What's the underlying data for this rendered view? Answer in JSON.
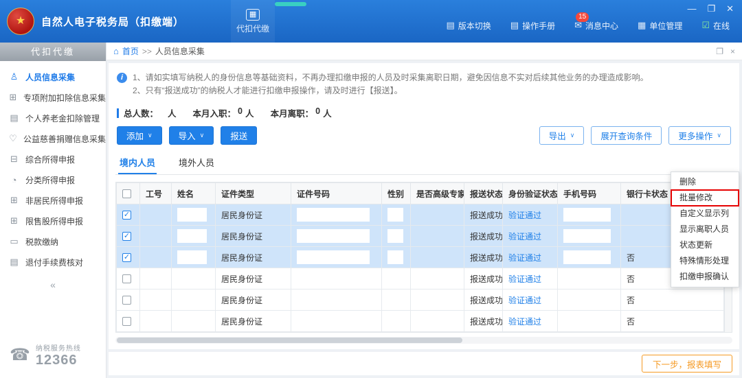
{
  "window_controls": {
    "minimize": "—",
    "maximize": "❐",
    "close": "✕"
  },
  "topbar": {
    "app_title": "自然人电子税务局（扣缴端）",
    "module_tab": {
      "label": "代扣代缴",
      "icon": "▦"
    },
    "right_items": [
      {
        "name": "version-switch",
        "icon": "▤",
        "label": "版本切换"
      },
      {
        "name": "user-manual",
        "icon": "▤",
        "label": "操作手册"
      },
      {
        "name": "message-center",
        "icon": "✉",
        "label": "消息中心",
        "badge": "15"
      },
      {
        "name": "unit-management",
        "icon": "▦",
        "label": "单位管理"
      },
      {
        "name": "online",
        "icon": "☑",
        "label": "在线"
      }
    ]
  },
  "sidebar": {
    "header": "代扣代缴",
    "items": [
      {
        "name": "personnel-info",
        "icon": "♙",
        "label": "人员信息采集",
        "active": true
      },
      {
        "name": "special-deduction",
        "icon": "⊞",
        "label": "专项附加扣除信息采集",
        "active": false
      },
      {
        "name": "pension-deduction",
        "icon": "▤",
        "label": "个人养老金扣除管理",
        "active": false
      },
      {
        "name": "charity-donation",
        "icon": "♡",
        "label": "公益慈善捐赠信息采集",
        "active": false
      },
      {
        "name": "comprehensive-income",
        "icon": "⊟",
        "label": "综合所得申报",
        "active": false
      },
      {
        "name": "classified-income",
        "icon": "◔",
        "label": "分类所得申报",
        "active": false
      },
      {
        "name": "nonresident-income",
        "icon": "⊞",
        "label": "非居民所得申报",
        "active": false
      },
      {
        "name": "restricted-shares",
        "icon": "⊞",
        "label": "限售股所得申报",
        "active": false
      },
      {
        "name": "tax-payment",
        "icon": "▭",
        "label": "税款缴纳",
        "active": false
      },
      {
        "name": "refund-fee-check",
        "icon": "▤",
        "label": "退付手续费核对",
        "active": false
      }
    ],
    "collapse_label": "«",
    "hotline": {
      "label": "纳税服务热线",
      "number": "12366"
    }
  },
  "breadcrumb": {
    "home": "首页",
    "separator": ">>",
    "current": "人员信息采集"
  },
  "notice": {
    "lines": [
      "1、请如实填写纳税人的身份信息等基础资料，不再办理扣缴申报的人员及时采集离职日期，避免因信息不实对后续其他业务的办理造成影响。",
      "2、只有“报送成功”的纳税人才能进行扣缴申报操作，请及时进行【报送】。"
    ]
  },
  "stats": {
    "segments": [
      {
        "name": "total",
        "label": "总人数：",
        "value": "",
        "unit": "人"
      },
      {
        "name": "month-join",
        "label": "本月入职：",
        "value": "0",
        "unit": "人"
      },
      {
        "name": "month-leave",
        "label": "本月离职：",
        "value": "0",
        "unit": "人"
      }
    ]
  },
  "toolbar": {
    "primary": [
      {
        "name": "add",
        "label": "添加",
        "dropdown": true
      },
      {
        "name": "import",
        "label": "导入",
        "dropdown": true
      },
      {
        "name": "submit",
        "label": "报送",
        "dropdown": false
      }
    ],
    "secondary": [
      {
        "name": "export",
        "label": "导出",
        "dropdown": true
      },
      {
        "name": "expand-query",
        "label": "展开查询条件",
        "dropdown": false
      },
      {
        "name": "more-actions",
        "label": "更多操作",
        "dropdown": true
      }
    ]
  },
  "tabs": [
    {
      "name": "domestic",
      "label": "境内人员",
      "active": true
    },
    {
      "name": "overseas",
      "label": "境外人员",
      "active": false
    }
  ],
  "table": {
    "headers": [
      "",
      "工号",
      "姓名",
      "证件类型",
      "证件号码",
      "性别",
      "是否高级专家",
      "报送状态",
      "身份验证状态",
      "手机号码",
      "银行卡状态"
    ],
    "rows": [
      {
        "checked": true,
        "cells": {
          "job_no": "",
          "name": "",
          "id_type": "居民身份证",
          "id_no": "",
          "gender": "",
          "expert": "",
          "submit_status": "报送成功",
          "verify_status": "验证通过",
          "phone": "",
          "bank_status": ""
        }
      },
      {
        "checked": true,
        "cells": {
          "job_no": "",
          "name": "",
          "id_type": "居民身份证",
          "id_no": "",
          "gender": "",
          "expert": "",
          "submit_status": "报送成功",
          "verify_status": "验证通过",
          "phone": "",
          "bank_status": ""
        }
      },
      {
        "checked": true,
        "cells": {
          "job_no": "",
          "name": "",
          "id_type": "居民身份证",
          "id_no": "",
          "gender": "",
          "expert": "",
          "submit_status": "报送成功",
          "verify_status": "验证通过",
          "phone": "",
          "bank_status": "否"
        }
      },
      {
        "checked": false,
        "cells": {
          "job_no": "",
          "name": "",
          "id_type": "居民身份证",
          "id_no": "",
          "gender": "",
          "expert": "",
          "submit_status": "报送成功",
          "verify_status": "验证通过",
          "phone": "",
          "bank_status": "否"
        }
      },
      {
        "checked": false,
        "cells": {
          "job_no": "",
          "name": "",
          "id_type": "居民身份证",
          "id_no": "",
          "gender": "",
          "expert": "",
          "submit_status": "报送成功",
          "verify_status": "验证通过",
          "phone": "",
          "bank_status": "否"
        }
      },
      {
        "checked": false,
        "cells": {
          "job_no": "",
          "name": "",
          "id_type": "居民身份证",
          "id_no": "",
          "gender": "",
          "expert": "",
          "submit_status": "报送成功",
          "verify_status": "验证通过",
          "phone": "",
          "bank_status": "否"
        }
      }
    ]
  },
  "more_menu": {
    "items": [
      {
        "name": "delete",
        "label": "删除",
        "highlight": false
      },
      {
        "name": "batch-edit",
        "label": "批量修改",
        "highlight": true
      },
      {
        "name": "custom-columns",
        "label": "自定义显示列",
        "highlight": false
      },
      {
        "name": "show-resigned",
        "label": "显示离职人员",
        "highlight": false
      },
      {
        "name": "status-update",
        "label": "状态更新",
        "highlight": false
      },
      {
        "name": "special-handling",
        "label": "特殊情形处理",
        "highlight": false
      },
      {
        "name": "withholding-confirm",
        "label": "扣缴申报确认",
        "highlight": false
      }
    ]
  },
  "footer": {
    "next_button": "下一步，报表填写"
  },
  "colors": {
    "accent": "#2080e8",
    "topbar": "#1b6fd0",
    "selected_row": "#cfe4fa",
    "highlight_box": "#e60000",
    "footer_button": "#f59a23",
    "badge": "#f4483c"
  }
}
